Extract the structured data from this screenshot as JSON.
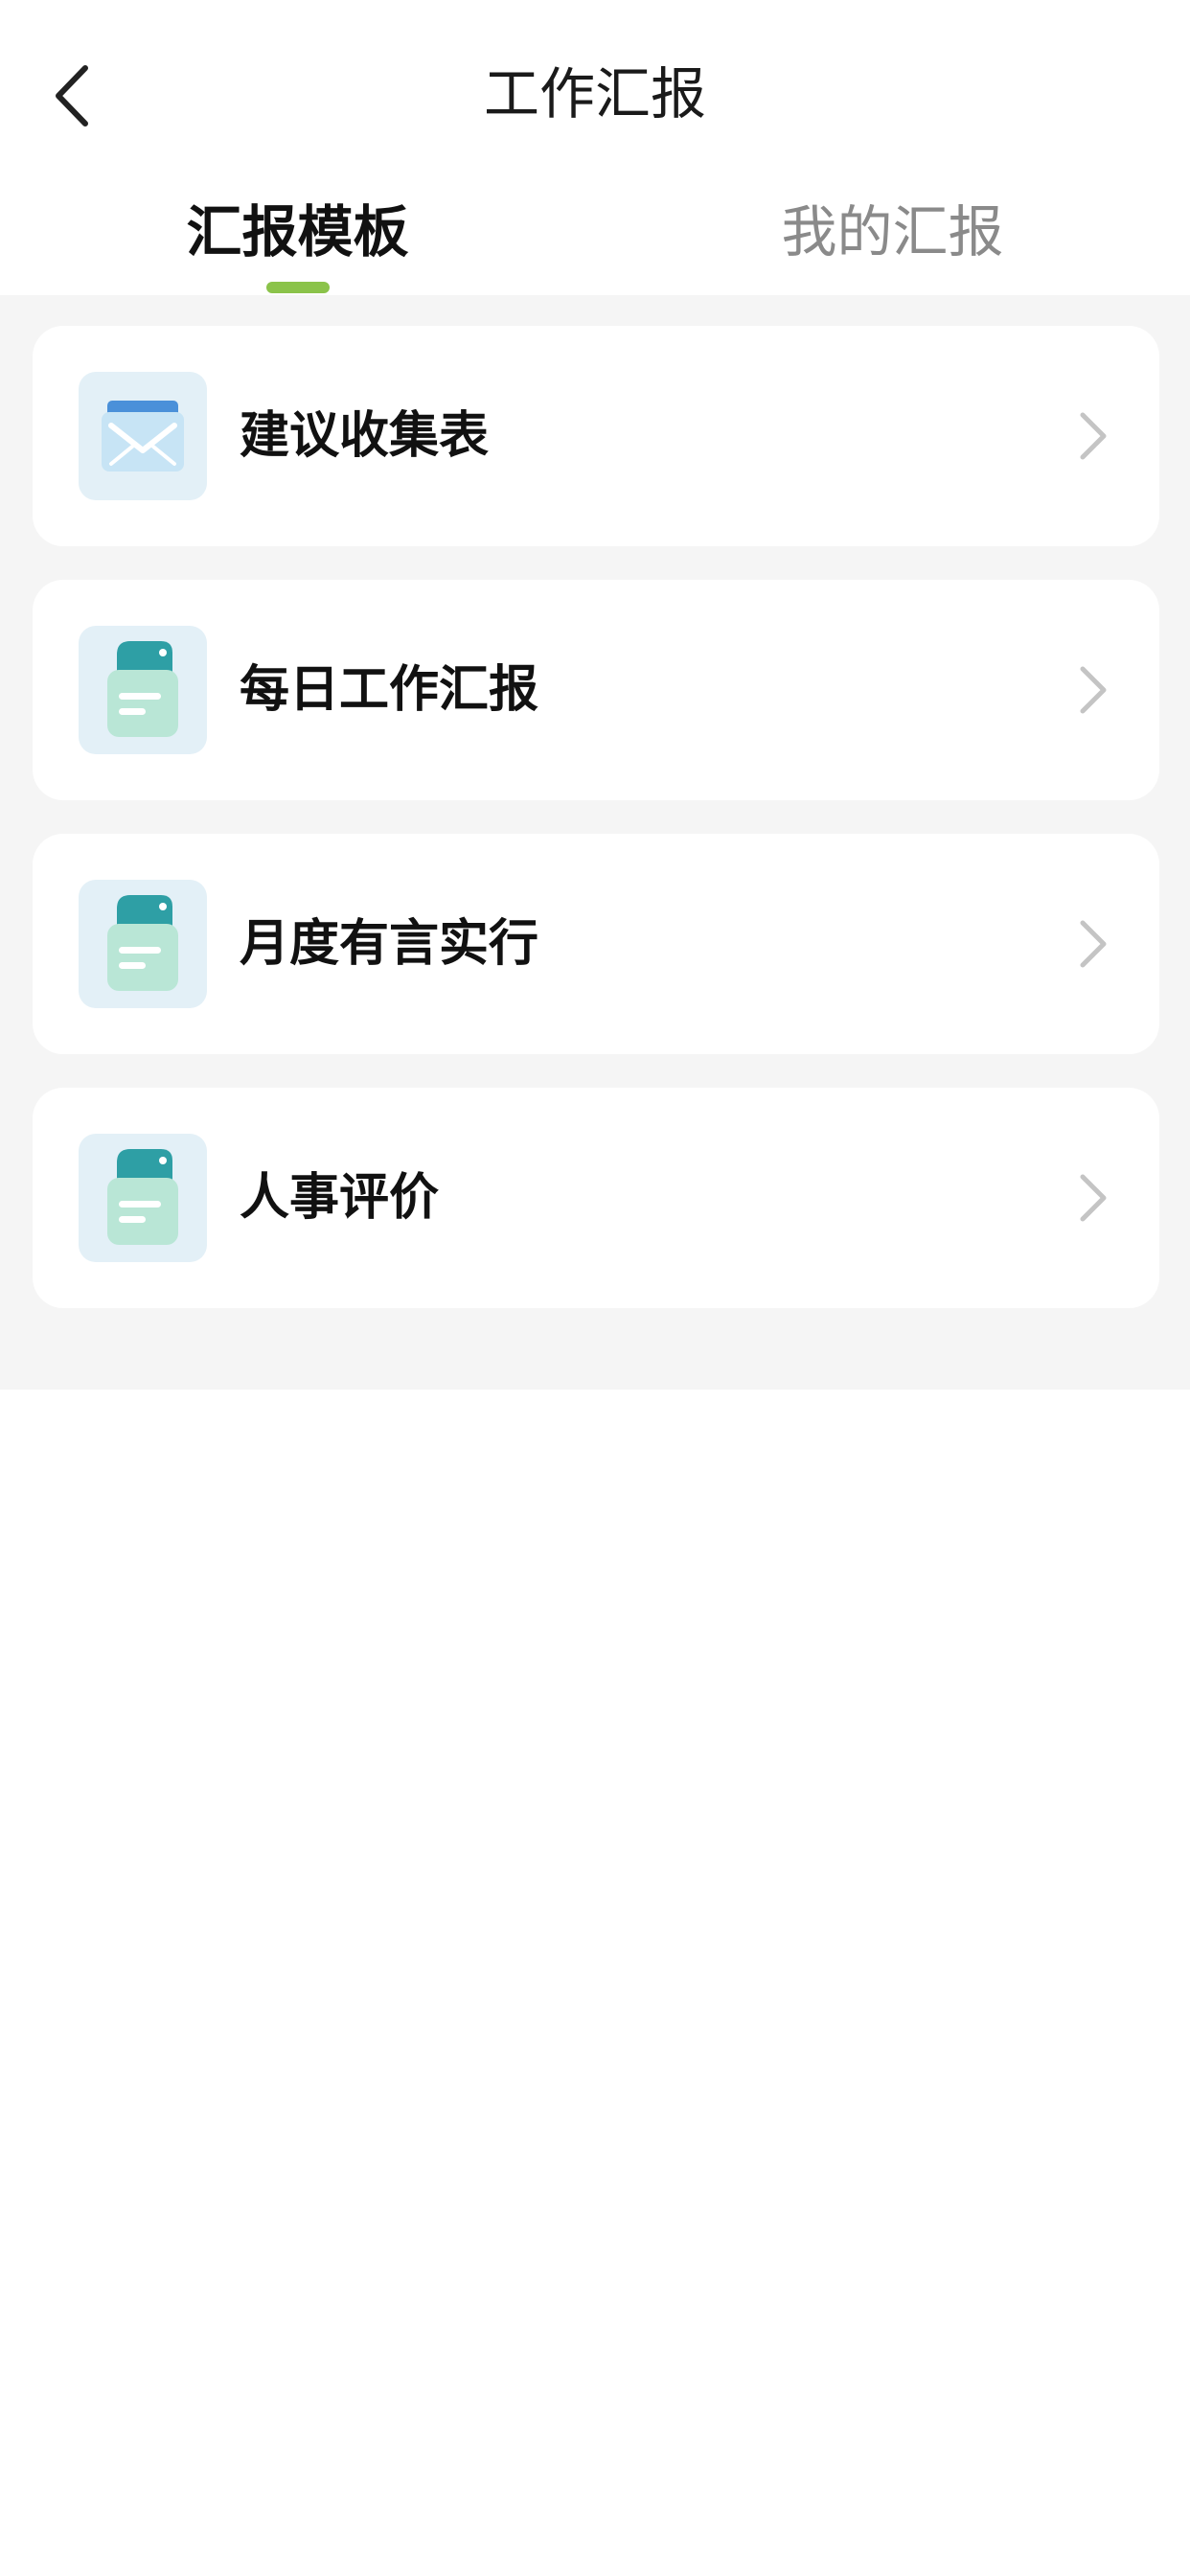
{
  "header": {
    "title": "工作汇报",
    "back_icon": "chevron-left-icon"
  },
  "tabs": [
    {
      "label": "汇报模板",
      "active": true
    },
    {
      "label": "我的汇报",
      "active": false
    }
  ],
  "colors": {
    "accent": "#8bc34a",
    "background": "#f5f5f5",
    "card": "#ffffff",
    "inactive_tab": "#8a8a8a"
  },
  "templates": [
    {
      "label": "建议收集表",
      "icon": "envelope-icon"
    },
    {
      "label": "每日工作汇报",
      "icon": "document-icon"
    },
    {
      "label": "月度有言实行",
      "icon": "document-icon"
    },
    {
      "label": "人事评价",
      "icon": "document-icon"
    }
  ]
}
